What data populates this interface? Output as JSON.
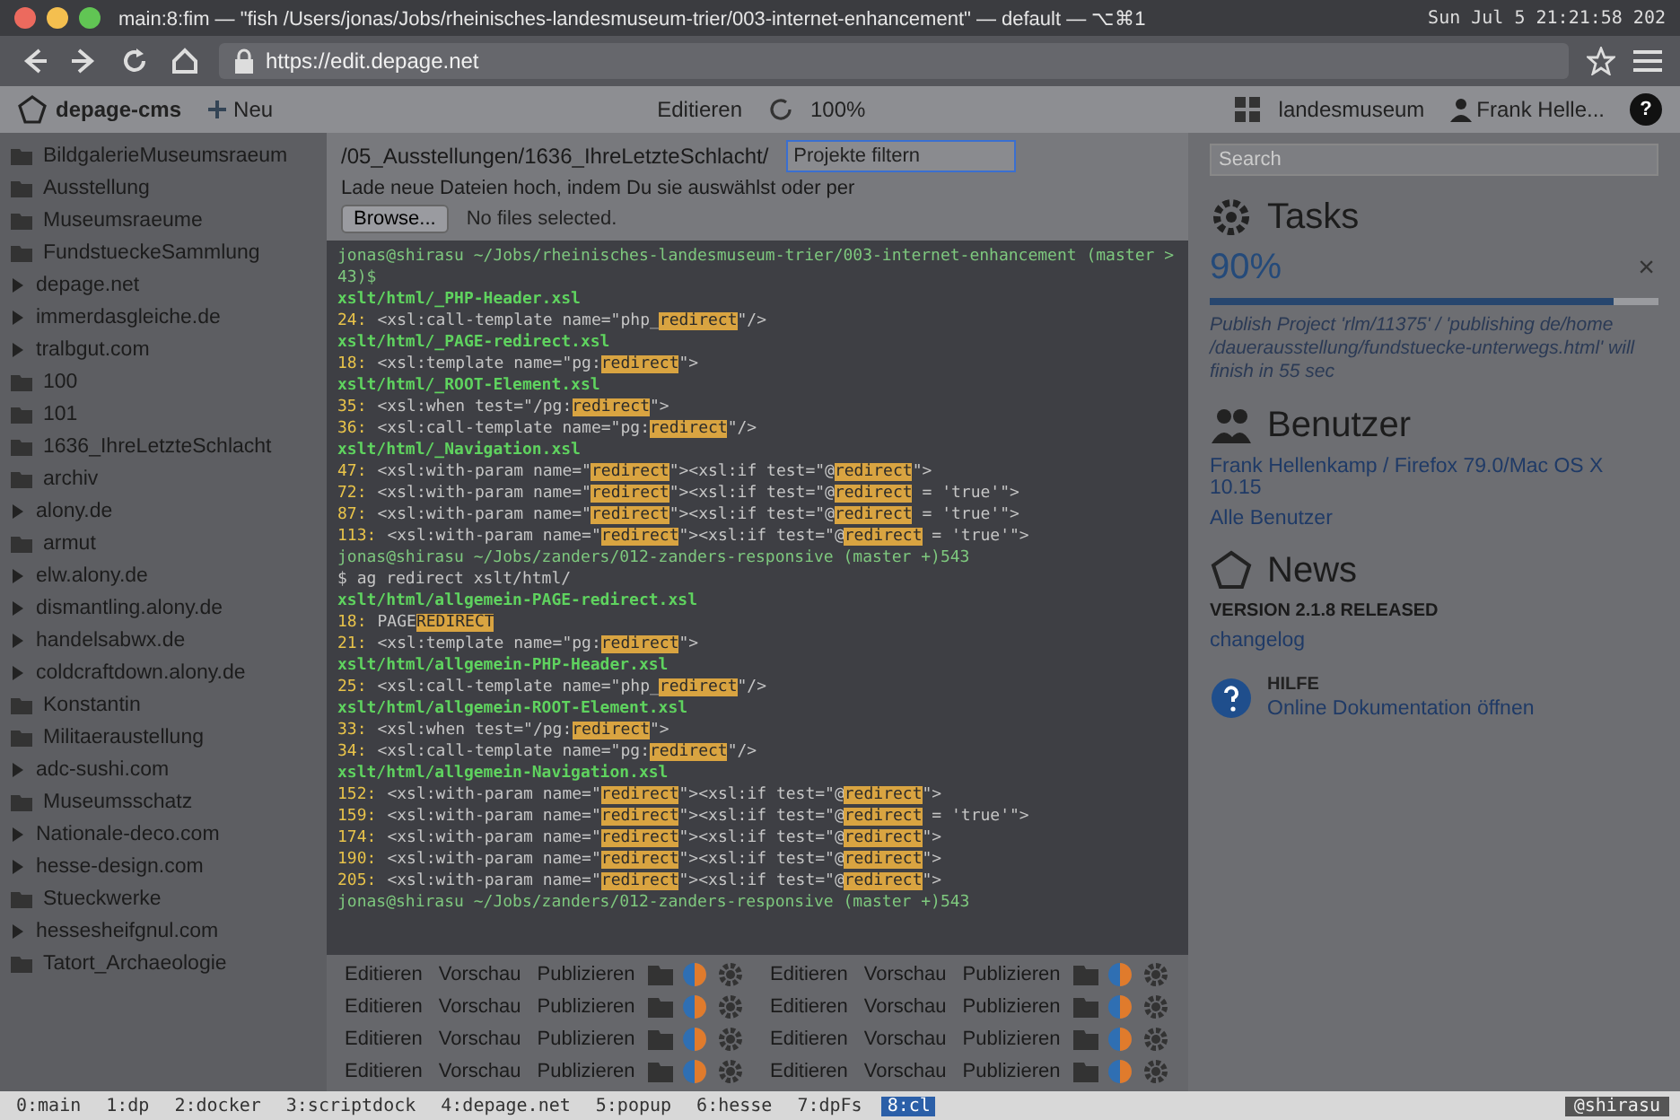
{
  "window": {
    "title": "main:8:fim — \"fish /Users/jonas/Jobs/rheinisches-landesmuseum-trier/003-internet-enhancement\" — default — ⌥⌘1",
    "clock": "Sun Jul  5 21:21:58 202"
  },
  "browser": {
    "url": "https://edit.depage.net"
  },
  "cms_toolbar": {
    "logo": "depage-cms",
    "new_label": "Neu",
    "edit_label": "Editieren",
    "zoom": "100%",
    "project": "landesmuseum",
    "user": "Frank Helle...",
    "help": "?"
  },
  "tree": {
    "items": [
      {
        "label": "BildgalerieMuseumsraeum",
        "kind": "folder"
      },
      {
        "label": "Ausstellung",
        "kind": "folder"
      },
      {
        "label": "Museumsraeume",
        "kind": "folder"
      },
      {
        "label": "FundstueckeSammlung",
        "kind": "folder"
      },
      {
        "label": "depage.net",
        "kind": "site"
      },
      {
        "label": "immerdasgleiche.de",
        "kind": "site"
      },
      {
        "label": "tralbgut.com",
        "kind": "site"
      },
      {
        "label": "100",
        "kind": "folder"
      },
      {
        "label": "101",
        "kind": "folder"
      },
      {
        "label": "1636_IhreLetzteSchlacht",
        "kind": "folder"
      },
      {
        "label": "archiv",
        "kind": "folder"
      },
      {
        "label": "alony.de",
        "kind": "site"
      },
      {
        "label": "armut",
        "kind": "folder"
      },
      {
        "label": "elw.alony.de",
        "kind": "site"
      },
      {
        "label": "dismantling.alony.de",
        "kind": "site"
      },
      {
        "label": "handelsabwx.de",
        "kind": "site"
      },
      {
        "label": "coldcraftdown.alony.de",
        "kind": "site"
      },
      {
        "label": "Konstantin",
        "kind": "folder"
      },
      {
        "label": "Militaeraustellung",
        "kind": "folder"
      },
      {
        "label": "adc-sushi.com",
        "kind": "site"
      },
      {
        "label": "Museumsschatz",
        "kind": "folder"
      },
      {
        "label": "Nationale-deco.com",
        "kind": "site"
      },
      {
        "label": "hesse-design.com",
        "kind": "site"
      },
      {
        "label": "Stueckwerke",
        "kind": "folder"
      },
      {
        "label": "hessesheifgnul.com",
        "kind": "site"
      },
      {
        "label": "Tatort_Archaeologie",
        "kind": "folder"
      }
    ]
  },
  "upload": {
    "path": "/05_Ausstellungen/1636_IhreLetzteSchlacht/",
    "hint": "Lade neue Dateien hoch, indem Du sie auswählst oder per",
    "browse": "Browse...",
    "no_files": "No files selected.",
    "filter_placeholder": "Projekte filtern"
  },
  "terminal": {
    "lines": [
      {
        "kind": "prompt",
        "parts": [
          "jonas@shirasu ~/Jobs/rheinisches-landesmuseum-trier/003-internet-enhancement (master >43)$"
        ]
      },
      {
        "kind": "file",
        "parts": [
          "xslt/html/_PHP-Header.xsl"
        ]
      },
      {
        "kind": "match",
        "num": "24:",
        "parts": [
          "<xsl:call-template name=\"php_",
          "redirect",
          "\"/>"
        ]
      },
      {
        "kind": "file",
        "parts": [
          "xslt/html/_PAGE-redirect.xsl"
        ]
      },
      {
        "kind": "match",
        "num": "18:",
        "parts": [
          "<xsl:template name=\"pg:",
          "redirect",
          "\">"
        ]
      },
      {
        "kind": "file",
        "parts": [
          "xslt/html/_ROOT-Element.xsl"
        ]
      },
      {
        "kind": "match",
        "num": "35:",
        "parts": [
          "<xsl:when test=\"/pg:",
          "redirect",
          "\">"
        ]
      },
      {
        "kind": "match",
        "num": "36:",
        "parts": [
          "<xsl:call-template name=\"pg:",
          "redirect",
          "\"/>"
        ]
      },
      {
        "kind": "file",
        "parts": [
          "xslt/html/_Navigation.xsl"
        ]
      },
      {
        "kind": "match",
        "num": "47:",
        "parts": [
          "<xsl:with-param name=\"",
          "redirect",
          "\"><xsl:if test=\"@",
          "redirect",
          "\">"
        ]
      },
      {
        "kind": "match",
        "num": "72:",
        "parts": [
          "<xsl:with-param name=\"",
          "redirect",
          "\"><xsl:if test=\"@",
          "redirect",
          " = 'true'\">"
        ]
      },
      {
        "kind": "match",
        "num": "87:",
        "parts": [
          "<xsl:with-param name=\"",
          "redirect",
          "\"><xsl:if test=\"@",
          "redirect",
          " = 'true'\">"
        ]
      },
      {
        "kind": "match",
        "num": "113:",
        "parts": [
          "<xsl:with-param name=\"",
          "redirect",
          "\"><xsl:if test=\"@",
          "redirect",
          " = 'true'\">"
        ]
      },
      {
        "kind": "prompt",
        "parts": [
          "jonas@shirasu ~/Jobs/zanders/012-zanders-responsive (master +)543"
        ]
      },
      {
        "kind": "plain",
        "parts": [
          "$ ag redirect xslt/html/"
        ]
      },
      {
        "kind": "file",
        "parts": [
          "xslt/html/allgemein-PAGE-redirect.xsl"
        ]
      },
      {
        "kind": "match",
        "num": "18:",
        "parts": [
          "PAGE",
          "REDIRECT"
        ]
      },
      {
        "kind": "match",
        "num": "21:",
        "parts": [
          "<xsl:template name=\"pg:",
          "redirect",
          "\">"
        ]
      },
      {
        "kind": "file",
        "parts": [
          "xslt/html/allgemein-PHP-Header.xsl"
        ]
      },
      {
        "kind": "match",
        "num": "25:",
        "parts": [
          "<xsl:call-template name=\"php_",
          "redirect",
          "\"/>"
        ]
      },
      {
        "kind": "file",
        "parts": [
          "xslt/html/allgemein-ROOT-Element.xsl"
        ]
      },
      {
        "kind": "match",
        "num": "33:",
        "parts": [
          "<xsl:when test=\"/pg:",
          "redirect",
          "\">"
        ]
      },
      {
        "kind": "match",
        "num": "34:",
        "parts": [
          "<xsl:call-template name=\"pg:",
          "redirect",
          "\"/>"
        ]
      },
      {
        "kind": "file",
        "parts": [
          "xslt/html/allgemein-Navigation.xsl"
        ]
      },
      {
        "kind": "match",
        "num": "152:",
        "parts": [
          "<xsl:with-param name=\"",
          "redirect",
          "\"><xsl:if test=\"@",
          "redirect",
          "\">"
        ]
      },
      {
        "kind": "match",
        "num": "159:",
        "parts": [
          "<xsl:with-param name=\"",
          "redirect",
          "\"><xsl:if test=\"@",
          "redirect",
          " = 'true'\">"
        ]
      },
      {
        "kind": "match",
        "num": "174:",
        "parts": [
          "<xsl:with-param name=\"",
          "redirect",
          "\"><xsl:if test=\"@",
          "redirect",
          "\">"
        ]
      },
      {
        "kind": "match",
        "num": "190:",
        "parts": [
          "<xsl:with-param name=\"",
          "redirect",
          "\"><xsl:if test=\"@",
          "redirect",
          "\">"
        ]
      },
      {
        "kind": "match",
        "num": "205:",
        "parts": [
          "<xsl:with-param name=\"",
          "redirect",
          "\"><xsl:if test=\"@",
          "redirect",
          "\">"
        ]
      },
      {
        "kind": "prompt",
        "parts": [
          "jonas@shirasu ~/Jobs/zanders/012-zanders-responsive (master +)543"
        ]
      }
    ]
  },
  "actions": {
    "rows": [
      {
        "edit": "Editieren",
        "preview": "Vorschau",
        "publish": "Publizieren"
      },
      {
        "edit": "Editieren",
        "preview": "Vorschau",
        "publish": "Publizieren"
      },
      {
        "edit": "Editieren",
        "preview": "Vorschau",
        "publish": "Publizieren"
      },
      {
        "edit": "Editieren",
        "preview": "Vorschau",
        "publish": "Publizieren"
      },
      {
        "edit": "Editieren",
        "preview": "Vorschau",
        "publish": "Publizieren"
      },
      {
        "edit": "Editieren",
        "preview": "Vorschau",
        "publish": "Publizieren"
      },
      {
        "edit": "Editieren",
        "preview": "Vorschau",
        "publish": "Publizieren"
      },
      {
        "edit": "Editieren",
        "preview": "Vorschau",
        "publish": "Publizieren"
      }
    ]
  },
  "dashboard": {
    "search_placeholder": "Search",
    "tasks": {
      "title": "Tasks",
      "percent": "90%",
      "level": 0.9,
      "close": "×",
      "message": "Publish Project 'rlm/11375' / 'publishing de/home /dauerausstellung/fundstuecke-unterwegs.html' will finish in 55 sec"
    },
    "users": {
      "title": "Benutzer",
      "entries": [
        "Frank Hellenkamp / Firefox 79.0/Mac OS X 10.15"
      ],
      "all": "Alle Benutzer"
    },
    "news": {
      "title": "News",
      "version": "VERSION 2.1.8 RELEASED",
      "link": "changelog"
    },
    "help": {
      "title": "HILFE",
      "link": "Online Dokumentation öffnen"
    }
  },
  "tmux": {
    "windows": [
      {
        "label": "0:main",
        "selected": false
      },
      {
        "label": "1:dp",
        "selected": false
      },
      {
        "label": "2:docker",
        "selected": false
      },
      {
        "label": "3:scriptdock",
        "selected": false
      },
      {
        "label": "4:depage.net",
        "selected": false
      },
      {
        "label": "5:popup",
        "selected": false
      },
      {
        "label": "6:hesse",
        "selected": false
      },
      {
        "label": "7:dpFs",
        "selected": false
      },
      {
        "label": "8:cl",
        "selected": true
      }
    ],
    "host": "@shirasu"
  }
}
